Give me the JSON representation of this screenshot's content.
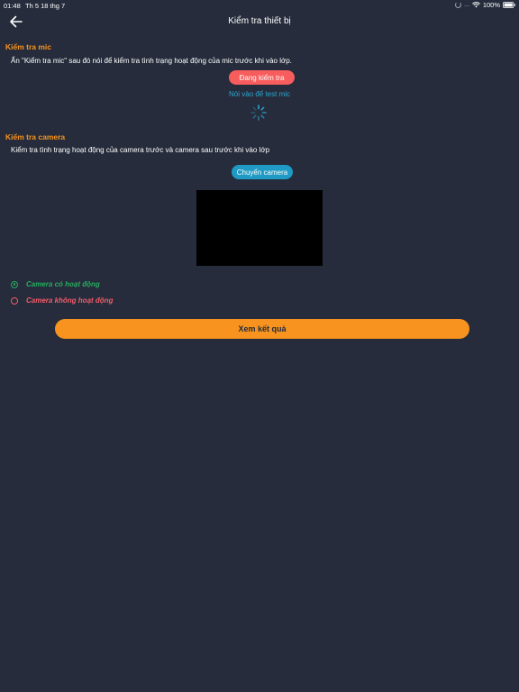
{
  "status_bar": {
    "time": "01:48",
    "date": "Th 5 18 thg 7",
    "battery": "100%"
  },
  "header": {
    "title": "Kiểm tra thiết bị",
    "back_icon": "arrow-left-icon"
  },
  "mic_section": {
    "title": "Kiểm tra mic",
    "description": "Ấn \"Kiểm tra mic\" sau đó nói để kiểm tra tình trạng hoạt động của mic trước khi vào lớp.",
    "testing_button_label": "Đang kiểm tra",
    "hint": "Nói vào để test mic"
  },
  "camera_section": {
    "title": "Kiểm tra camera",
    "description": "Kiểm tra tình trạng hoạt động của camera trước và camera sau trước khi vào lớp",
    "switch_button_label": "Chuyển camera",
    "options": [
      {
        "label": "Camera có hoạt động",
        "selected": true
      },
      {
        "label": "Camera không hoạt động",
        "selected": false
      }
    ]
  },
  "result_button_label": "Xem kết quả",
  "colors": {
    "background": "#262c3b",
    "accent_orange": "#f7931e",
    "danger_red": "#f85d5d",
    "info_blue": "#1e9ac4",
    "success_green": "#27ae60"
  }
}
